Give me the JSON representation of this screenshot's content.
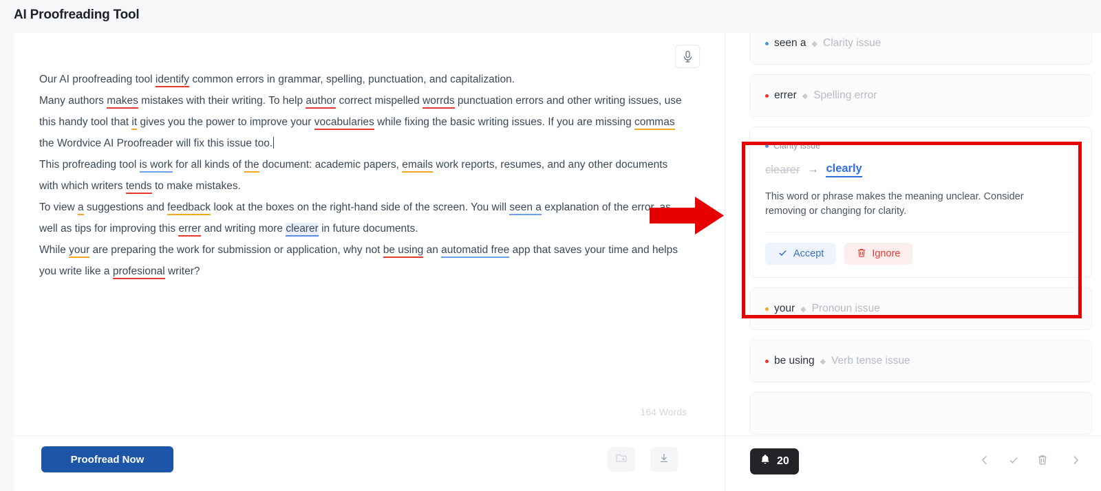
{
  "header": {
    "title": "AI Proofreading Tool"
  },
  "editor": {
    "mic_icon": "microphone-icon",
    "word_count": "164 Words",
    "paragraphs": [
      {
        "id": "p1",
        "runs": [
          {
            "t": "Our AI proofreading tool "
          },
          {
            "t": "identify",
            "mark": "red"
          },
          {
            "t": " common errors in grammar, spelling, punctuation, and capitalization."
          }
        ]
      },
      {
        "id": "p2",
        "runs": [
          {
            "t": "Many authors "
          },
          {
            "t": "makes",
            "mark": "red"
          },
          {
            "t": " mistakes with their writing. To help "
          },
          {
            "t": "author",
            "mark": "red"
          },
          {
            "t": " correct mispelled "
          },
          {
            "t": "worrds",
            "mark": "red"
          },
          {
            "t": " punctuation errors and other writing issues, use this handy tool that "
          },
          {
            "t": "it",
            "mark": "orange"
          },
          {
            "t": " gives you the power to improve your "
          },
          {
            "t": "vocabularies",
            "mark": "red"
          },
          {
            "t": " while fixing the basic writing issues. If you are missing "
          },
          {
            "t": "commas",
            "mark": "orange"
          },
          {
            "t": " the Wordvice AI Proofreader will fix this issue too."
          },
          {
            "t": "",
            "caret": true
          }
        ]
      },
      {
        "id": "p3",
        "runs": [
          {
            "t": "This profreading tool "
          },
          {
            "t": "is work",
            "mark": "blue"
          },
          {
            "t": " for all kinds of "
          },
          {
            "t": "the",
            "mark": "orange"
          },
          {
            "t": " document: academic papers, "
          },
          {
            "t": "emails",
            "mark": "orange"
          },
          {
            "t": " work reports, resumes, and any other documents with which writers "
          },
          {
            "t": "tends",
            "mark": "red"
          },
          {
            "t": " to make mistakes."
          }
        ]
      },
      {
        "id": "p4",
        "runs": [
          {
            "t": "To view "
          },
          {
            "t": "a",
            "mark": "orange"
          },
          {
            "t": " suggestions and "
          },
          {
            "t": "feedback",
            "mark": "orange"
          },
          {
            "t": " look at the boxes on the right-hand side of the screen. You will "
          },
          {
            "t": "seen a",
            "mark": "blue"
          },
          {
            "t": " explanation of the error, as well as tips for improving this "
          },
          {
            "t": "errer",
            "mark": "red"
          },
          {
            "t": " and writing more "
          },
          {
            "t": "clearer",
            "mark": "blue-sel"
          },
          {
            "t": " in future documents."
          }
        ]
      },
      {
        "id": "p5",
        "runs": [
          {
            "t": "While "
          },
          {
            "t": "your",
            "mark": "orange"
          },
          {
            "t": " are preparing the work for submission or application, why not "
          },
          {
            "t": "be using",
            "mark": "red"
          },
          {
            "t": " an "
          },
          {
            "t": "automatid free",
            "mark": "blue"
          },
          {
            "t": " app that saves your time and helps you write like a "
          },
          {
            "t": "profesional",
            "mark": "red"
          },
          {
            "t": " writer?"
          }
        ]
      }
    ]
  },
  "toolbar": {
    "proofread_label": "Proofread Now",
    "folder_icon": "folder-download-icon",
    "download_icon": "download-icon"
  },
  "suggestions": [
    {
      "word": "seen a",
      "type": "Clarity issue",
      "dot": "#4a90e2",
      "state": "collapsed"
    },
    {
      "word": "errer",
      "type": "Spelling error",
      "dot": "#e8392e",
      "state": "collapsed"
    },
    {
      "word": "clearer",
      "type": "Clarity issue",
      "dot": "#4a90e2",
      "state": "expanded",
      "replacement": "clearly",
      "arrow": "→",
      "description": "This word or phrase makes the meaning unclear. Consider removing or changing for clarity.",
      "accept_label": "Accept",
      "ignore_label": "Ignore",
      "accept_icon": "check-icon",
      "ignore_icon": "trash-icon"
    },
    {
      "word": "your",
      "type": "Pronoun issue",
      "dot": "#f5a623",
      "state": "collapsed"
    },
    {
      "word": "be using",
      "type": "Verb tense issue",
      "dot": "#e8392e",
      "state": "collapsed"
    }
  ],
  "panel_bar": {
    "bell_icon": "bell-icon",
    "notification_count": "20",
    "prev_icon": "chevron-left-icon",
    "check_icon": "check-icon",
    "trash_icon": "trash-icon",
    "next_icon": "chevron-right-icon"
  },
  "annotation": {
    "rect_color": "#e60000",
    "arrow_color": "#e60000"
  },
  "colors": {
    "accent_blue": "#1d56a8",
    "link_blue": "#2f6fe0",
    "error_red": "#e8392e",
    "warn_orange": "#f5a623",
    "info_blue": "#6d9eeb"
  }
}
